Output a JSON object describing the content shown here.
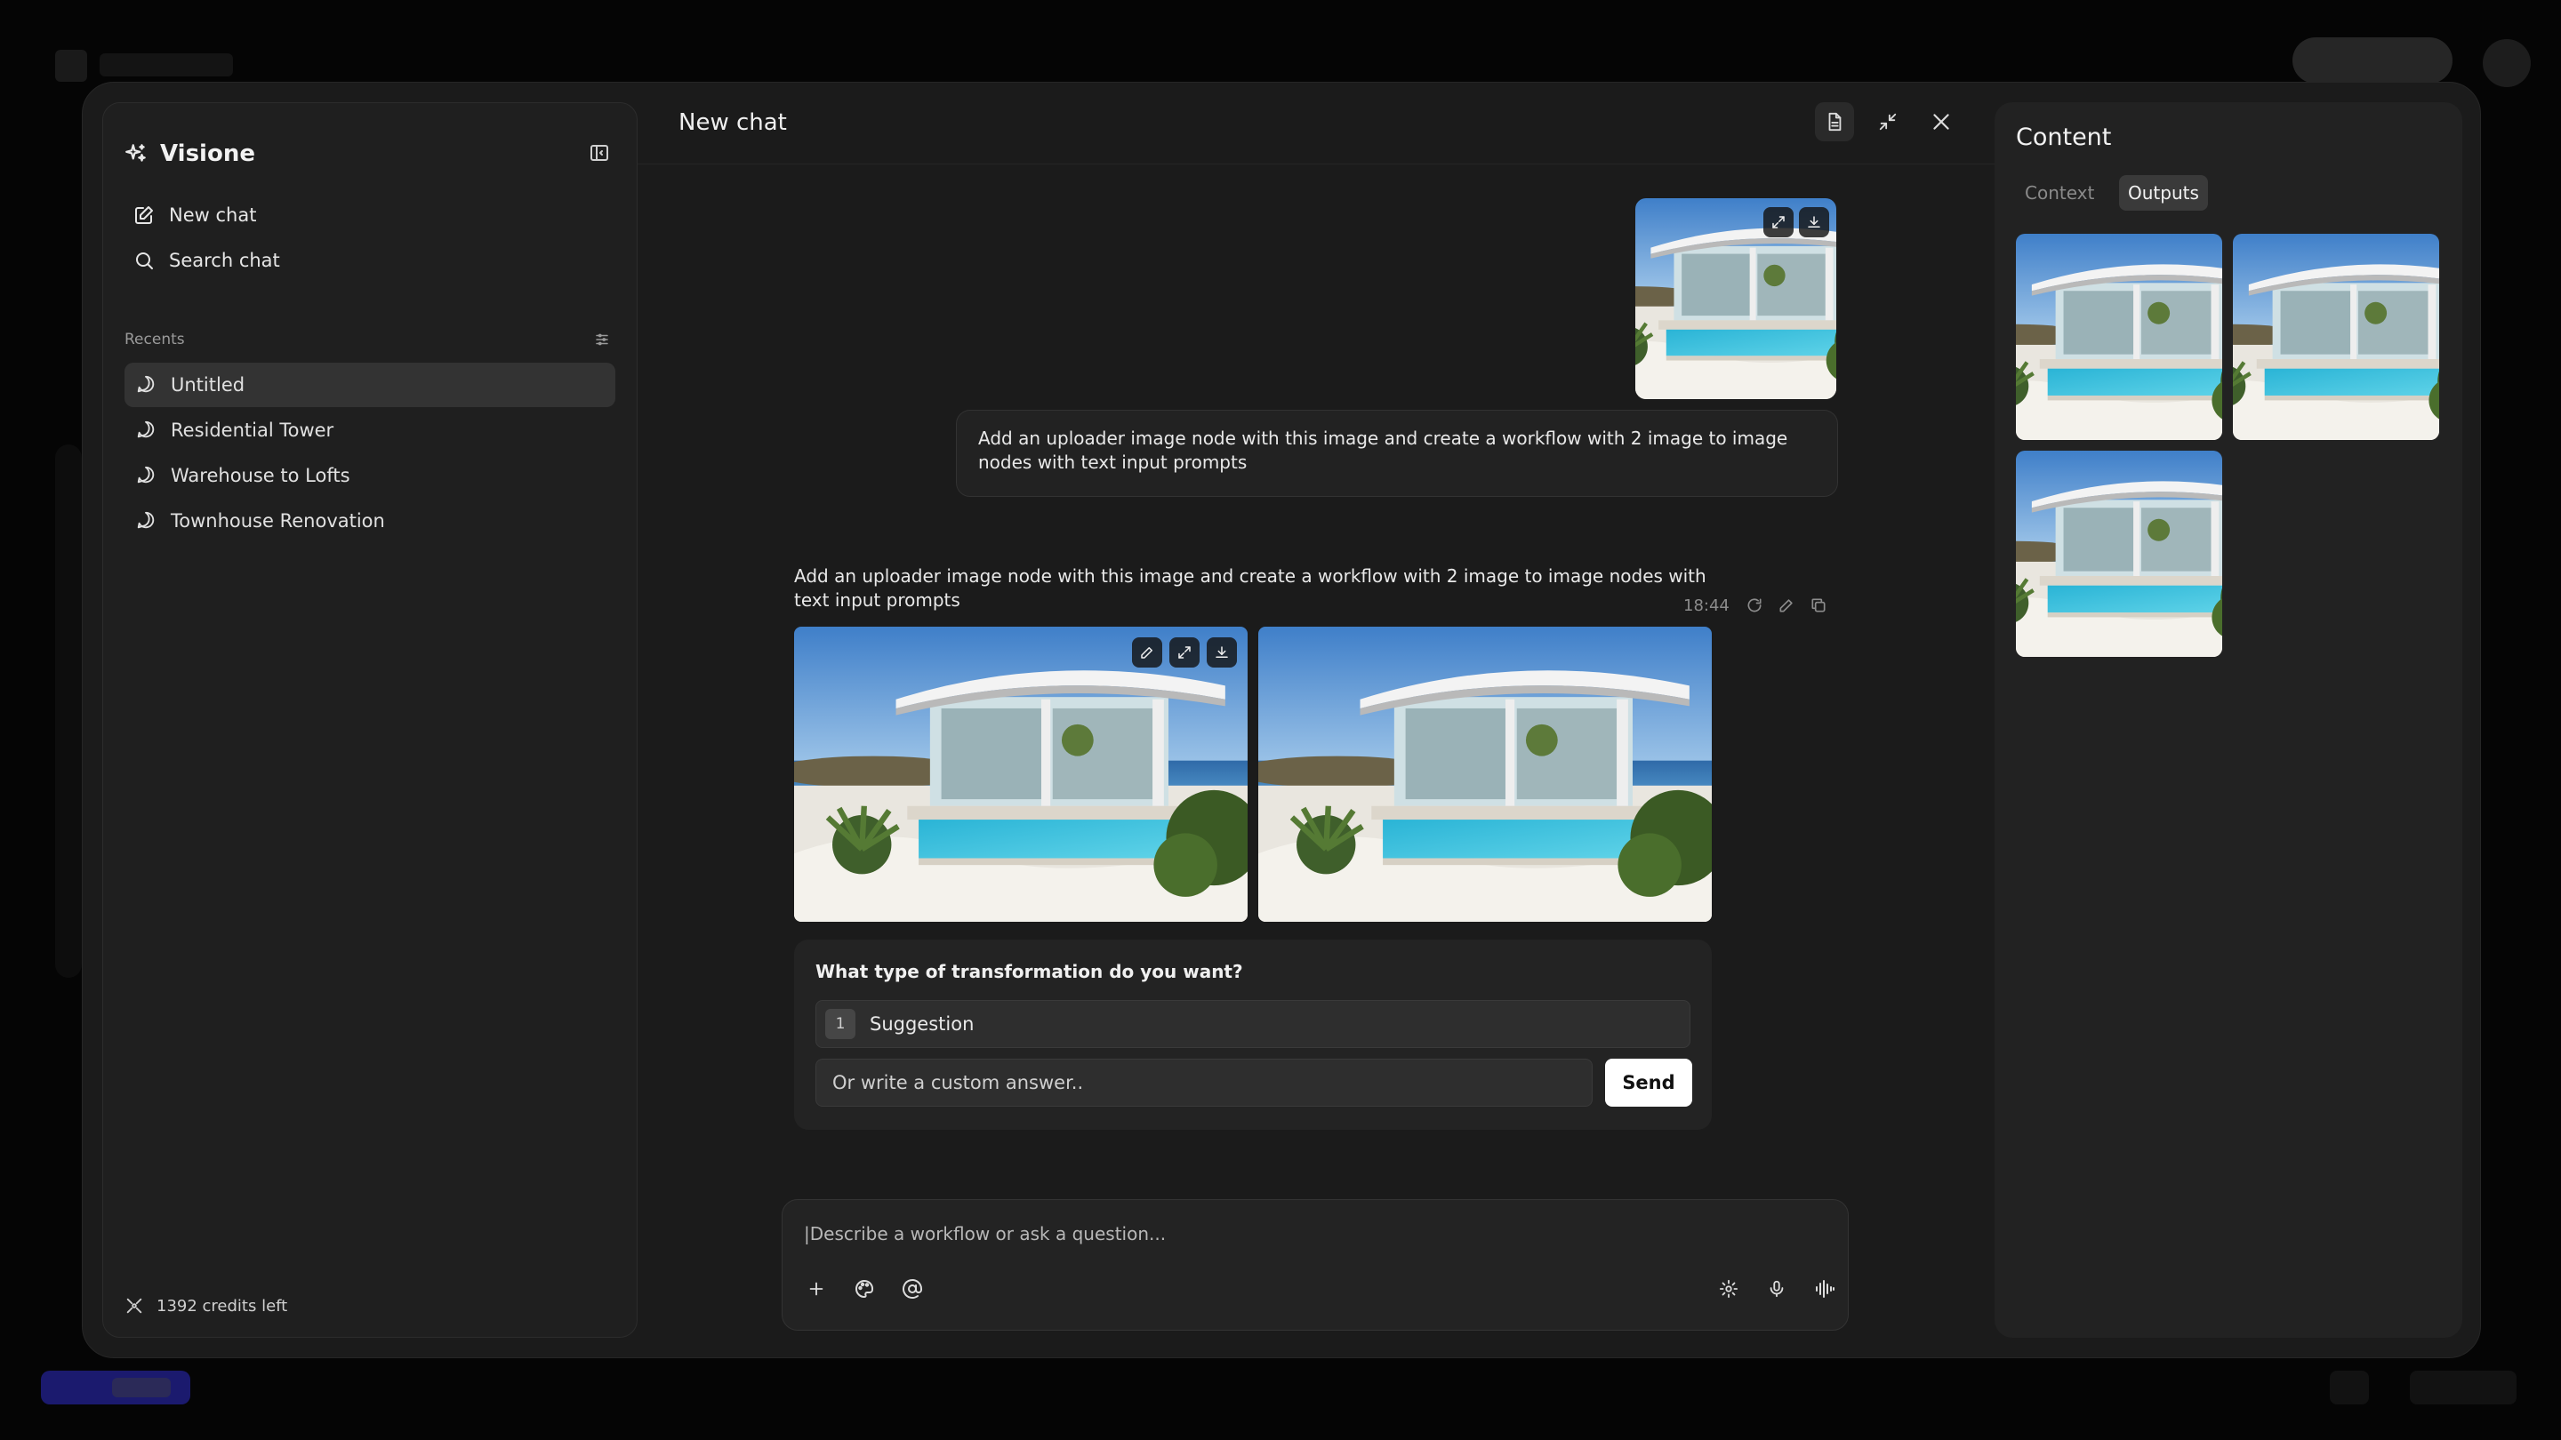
{
  "sidebar": {
    "brand": "Visione",
    "new_chat": "New chat",
    "search_chat": "Search chat",
    "recents_label": "Recents",
    "recents": [
      {
        "label": "Untitled",
        "active": true
      },
      {
        "label": "Residential Tower",
        "active": false
      },
      {
        "label": "Warehouse to Lofts",
        "active": false
      },
      {
        "label": "Townhouse Renovation",
        "active": false
      }
    ],
    "credits": "1392 credits left"
  },
  "chat": {
    "title": "New chat",
    "user_message": "Add an uploader image node with this image and create a workflow with 2 image to image nodes with text input prompts",
    "user_time": "18:44",
    "assistant_message": "Add an uploader image node with this image and create a workflow with 2 image to image nodes with text input prompts",
    "question": {
      "title": "What type of transformation do you want?",
      "suggestion_number": "1",
      "suggestion_label": "Suggestion",
      "custom_placeholder": "Or write a custom answer..",
      "send_label": "Send"
    },
    "composer_placeholder": "|Describe a workflow or ask a question..."
  },
  "content_panel": {
    "title": "Content",
    "tabs": [
      {
        "label": "Context",
        "active": false
      },
      {
        "label": "Outputs",
        "active": true
      }
    ],
    "output_count": 3
  },
  "colors": {
    "modal_bg": "#1b1b1b",
    "sidebar_bg": "#1f1f1f",
    "active_item": "#333333",
    "send_button": "#ffffff"
  }
}
